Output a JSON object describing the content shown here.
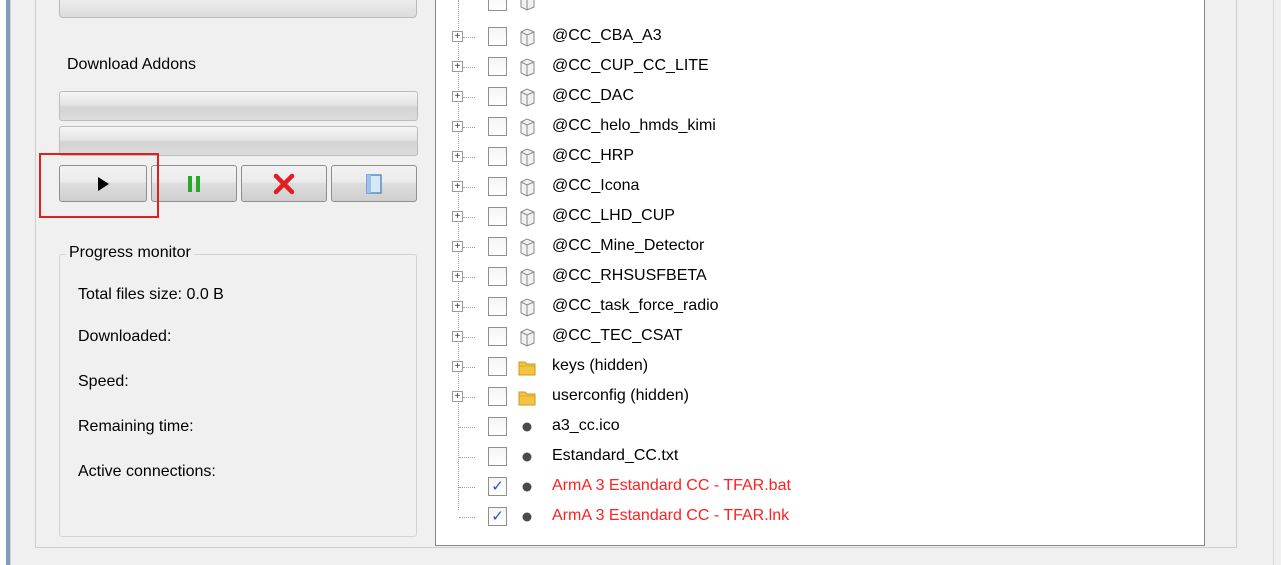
{
  "download": {
    "title": "Download Addons",
    "buttons": [
      "play-icon",
      "pause-icon",
      "stop-icon",
      "log-icon"
    ]
  },
  "progress": {
    "legend": "Progress monitor",
    "total_size": "Total files size: 0.0 B",
    "downloaded": "Downloaded:",
    "speed": "Speed:",
    "remaining": "Remaining time:",
    "connections": "Active connections:"
  },
  "tree": {
    "items": [
      {
        "label": "@CC_CBA_A3",
        "type": "addon",
        "checked": false,
        "highlight": false
      },
      {
        "label": "@CC_CUP_CC_LITE",
        "type": "addon",
        "checked": false,
        "highlight": false
      },
      {
        "label": "@CC_DAC",
        "type": "addon",
        "checked": false,
        "highlight": false
      },
      {
        "label": "@CC_helo_hmds_kimi",
        "type": "addon",
        "checked": false,
        "highlight": false
      },
      {
        "label": "@CC_HRP",
        "type": "addon",
        "checked": false,
        "highlight": false
      },
      {
        "label": "@CC_Icona",
        "type": "addon",
        "checked": false,
        "highlight": false
      },
      {
        "label": "@CC_LHD_CUP",
        "type": "addon",
        "checked": false,
        "highlight": false
      },
      {
        "label": "@CC_Mine_Detector",
        "type": "addon",
        "checked": false,
        "highlight": false
      },
      {
        "label": "@CC_RHSUSFBETA",
        "type": "addon",
        "checked": false,
        "highlight": false
      },
      {
        "label": "@CC_task_force_radio",
        "type": "addon",
        "checked": false,
        "highlight": false
      },
      {
        "label": "@CC_TEC_CSAT",
        "type": "addon",
        "checked": false,
        "highlight": false
      },
      {
        "label": "keys (hidden)",
        "type": "folder",
        "checked": false,
        "highlight": false
      },
      {
        "label": "userconfig (hidden)",
        "type": "folder",
        "checked": false,
        "highlight": false
      },
      {
        "label": "a3_cc.ico",
        "type": "file",
        "checked": false,
        "highlight": false
      },
      {
        "label": "Estandard_CC.txt",
        "type": "file",
        "checked": false,
        "highlight": false
      },
      {
        "label": "ArmA 3 Estandard CC - TFAR.bat",
        "type": "file",
        "checked": true,
        "highlight": true
      },
      {
        "label": "ArmA 3 Estandard CC - TFAR.lnk",
        "type": "file",
        "checked": true,
        "highlight": true
      }
    ]
  },
  "colors": {
    "highlight_text": "#ff2020",
    "focus_box": "#e02020",
    "check": "#1f56d8"
  }
}
